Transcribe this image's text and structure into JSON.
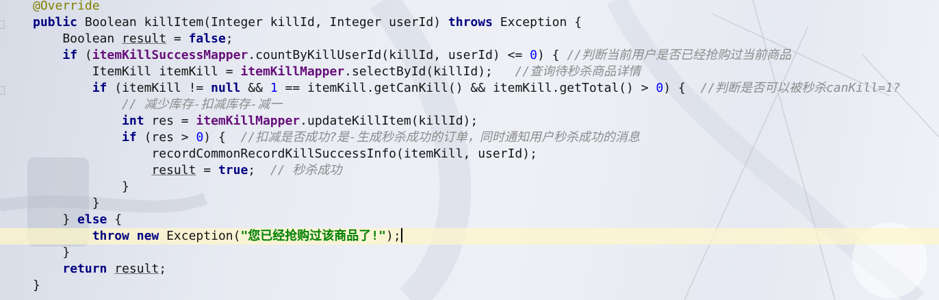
{
  "editor": {
    "lines": [
      [
        {
          "t": "@Override",
          "c": "ann"
        }
      ],
      [
        {
          "t": "public",
          "c": "kw"
        },
        {
          "t": " Boolean killItem(Integer killId, Integer userId) "
        },
        {
          "t": "throws",
          "c": "kw"
        },
        {
          "t": " Exception {"
        }
      ],
      [
        {
          "t": "    Boolean "
        },
        {
          "t": "result",
          "c": "ul"
        },
        {
          "t": " = "
        },
        {
          "t": "false",
          "c": "kw"
        },
        {
          "t": ";"
        }
      ],
      [
        {
          "t": "    "
        },
        {
          "t": "if",
          "c": "kw"
        },
        {
          "t": " ("
        },
        {
          "t": "itemKillSuccessMapper",
          "c": "fld"
        },
        {
          "t": ".countByKillUserId(killId, userId) <= "
        },
        {
          "t": "0",
          "c": "num"
        },
        {
          "t": ") { "
        },
        {
          "t": "//判断当前用户是否已经抢购过当前商品",
          "c": "cmt"
        }
      ],
      [
        {
          "t": "        ItemKill itemKill = "
        },
        {
          "t": "itemKillMapper",
          "c": "fld"
        },
        {
          "t": ".selectById(killId);   "
        },
        {
          "t": "//查询待秒杀商品详情",
          "c": "cmt"
        }
      ],
      [
        {
          "t": "        "
        },
        {
          "t": "if",
          "c": "kw"
        },
        {
          "t": " (itemKill != "
        },
        {
          "t": "null",
          "c": "kw"
        },
        {
          "t": " && "
        },
        {
          "t": "1",
          "c": "num"
        },
        {
          "t": " == itemKill.getCanKill() && itemKill.getTotal() > "
        },
        {
          "t": "0",
          "c": "num"
        },
        {
          "t": ") {  "
        },
        {
          "t": "//判断是否可以被秒杀canKill=1?",
          "c": "cmt"
        }
      ],
      [
        {
          "t": "            "
        },
        {
          "t": "// 减少库存-扣减库存-减一",
          "c": "cmt"
        }
      ],
      [
        {
          "t": "            "
        },
        {
          "t": "int",
          "c": "kw"
        },
        {
          "t": " res = "
        },
        {
          "t": "itemKillMapper",
          "c": "fld"
        },
        {
          "t": ".updateKillItem(killId);"
        }
      ],
      [
        {
          "t": "            "
        },
        {
          "t": "if",
          "c": "kw"
        },
        {
          "t": " (res > "
        },
        {
          "t": "0",
          "c": "num"
        },
        {
          "t": ") {  "
        },
        {
          "t": "//扣减是否成功?是-生成秒杀成功的订单，同时通知用户秒杀成功的消息",
          "c": "cmt"
        }
      ],
      [
        {
          "t": "                recordCommonRecordKillSuccessInfo(itemKill, userId);"
        }
      ],
      [
        {
          "t": "                "
        },
        {
          "t": "result",
          "c": "ul"
        },
        {
          "t": " = "
        },
        {
          "t": "true",
          "c": "kw"
        },
        {
          "t": ";  "
        },
        {
          "t": "// 秒杀成功",
          "c": "cmt"
        }
      ],
      [
        {
          "t": "            }"
        }
      ],
      [
        {
          "t": "        }"
        }
      ],
      [
        {
          "t": "    } "
        },
        {
          "t": "else",
          "c": "kw"
        },
        {
          "t": " {"
        }
      ],
      [
        {
          "t": "        "
        },
        {
          "t": "throw",
          "c": "kw"
        },
        {
          "t": " "
        },
        {
          "t": "new",
          "c": "kw"
        },
        {
          "t": " Exception("
        },
        {
          "t": "\"您已经抢购过该商品了!\"",
          "c": "str"
        },
        {
          "t": ");"
        }
      ],
      [
        {
          "t": "    }"
        }
      ],
      [
        {
          "t": "    "
        },
        {
          "t": "return",
          "c": "kw"
        },
        {
          "t": " "
        },
        {
          "t": "result",
          "c": "ul"
        },
        {
          "t": ";"
        }
      ],
      [
        {
          "t": "}"
        }
      ]
    ],
    "current_line_index": 14,
    "caret_after_text": true
  },
  "theme": {
    "keyword": "#000080",
    "field": "#660e7a",
    "number": "#0000ff",
    "string": "#008000",
    "comment": "#8c8c8c",
    "annotation": "#808000",
    "current_line": "#fdf6c8"
  }
}
